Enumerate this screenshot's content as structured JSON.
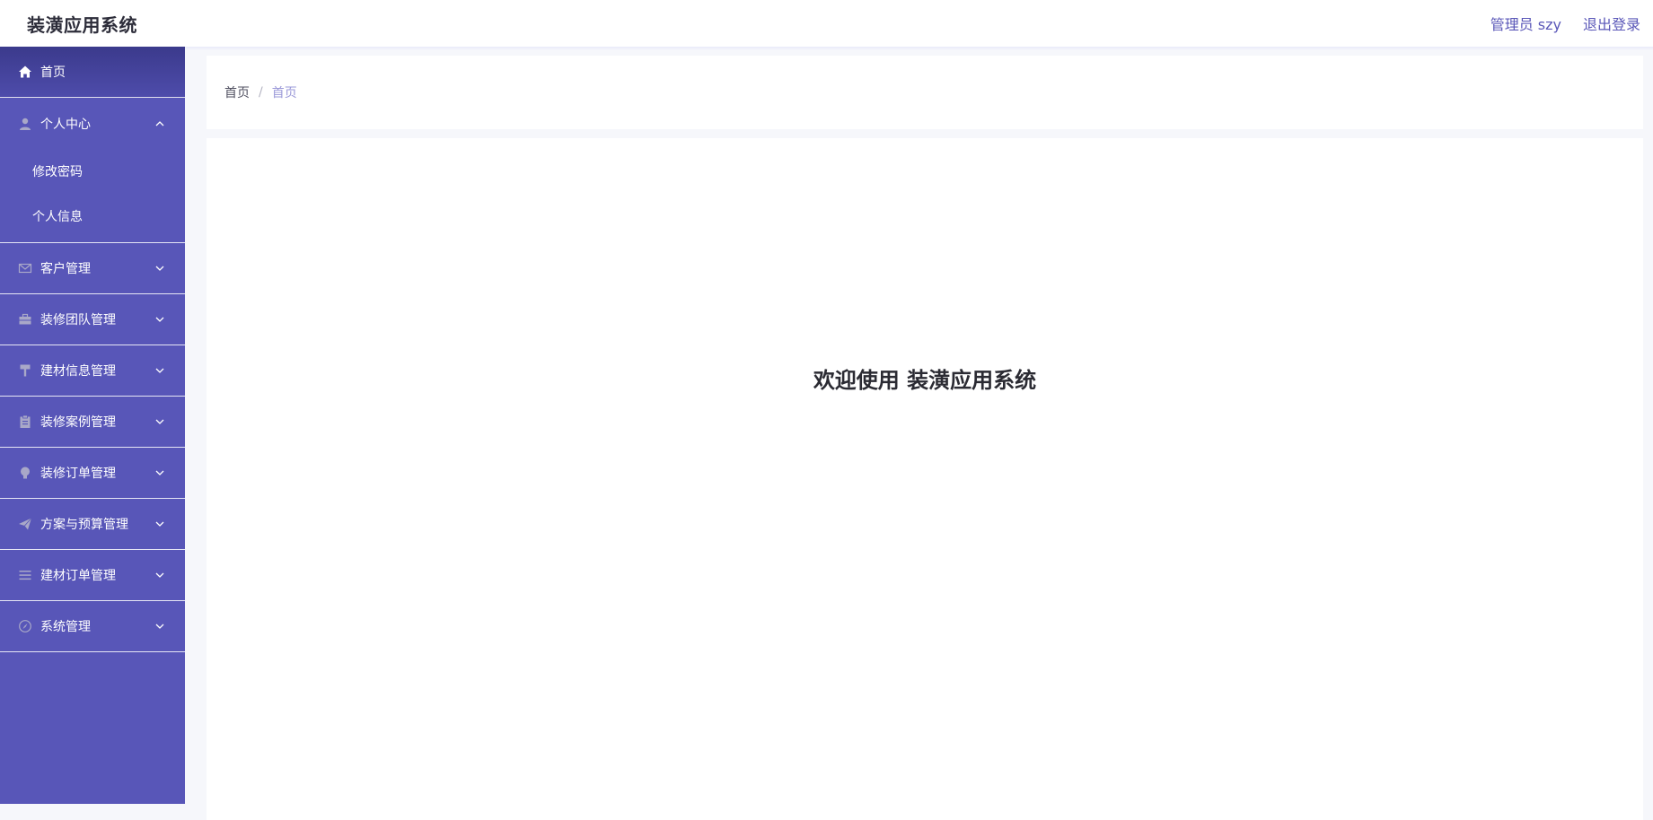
{
  "header": {
    "title": "装潢应用系统",
    "user_label": "管理员 szy",
    "logout_label": "退出登录"
  },
  "sidebar": {
    "home": {
      "label": "首页",
      "icon": "home-icon"
    },
    "personal": {
      "label": "个人中心",
      "icon": "user-icon",
      "children": [
        "修改密码",
        "个人信息"
      ]
    },
    "items": [
      {
        "label": "客户管理",
        "icon": "mail-icon"
      },
      {
        "label": "装修团队管理",
        "icon": "briefcase-icon"
      },
      {
        "label": "建材信息管理",
        "icon": "paint-roller-icon"
      },
      {
        "label": "装修案例管理",
        "icon": "clipboard-icon"
      },
      {
        "label": "装修订单管理",
        "icon": "bulb-icon"
      },
      {
        "label": "方案与预算管理",
        "icon": "paper-plane-icon"
      },
      {
        "label": "建材订单管理",
        "icon": "list-icon"
      },
      {
        "label": "系统管理",
        "icon": "compass-icon"
      }
    ]
  },
  "breadcrumb": {
    "home": "首页",
    "separator": "/",
    "current": "首页"
  },
  "main": {
    "welcome_text": "欢迎使用 装潢应用系统"
  },
  "colors": {
    "sidebar_bg": "#5856b8",
    "accent": "#5a57b8",
    "icon_gray": "#a9a8c8"
  }
}
